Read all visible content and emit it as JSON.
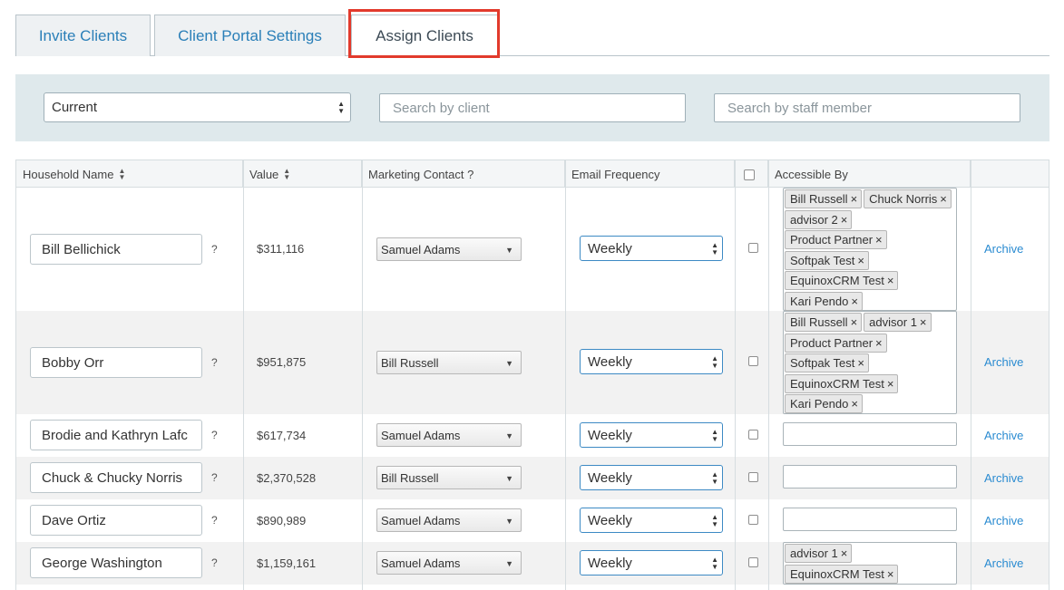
{
  "tabs": [
    {
      "label": "Invite Clients"
    },
    {
      "label": "Client Portal Settings"
    },
    {
      "label": "Assign Clients",
      "active": true
    }
  ],
  "filters": {
    "status_value": "Current",
    "client_search_placeholder": "Search by client",
    "staff_search_placeholder": "Search by staff member"
  },
  "table": {
    "headers": {
      "household": "Household Name",
      "value": "Value",
      "marketing": "Marketing Contact ?",
      "email_freq": "Email Frequency",
      "accessible": "Accessible By"
    },
    "rows": [
      {
        "name": "Bill Bellichick",
        "q": "?",
        "value": "$311,116",
        "contact": "Samuel Adams",
        "frequency": "Weekly",
        "tags": [
          "Bill Russell",
          "Chuck Norris",
          "advisor 2",
          "Product Partner",
          "Softpak Test",
          "EquinoxCRM Test",
          "Kari Pendo"
        ],
        "action": "Archive"
      },
      {
        "name": "Bobby Orr",
        "q": "?",
        "value": "$951,875",
        "contact": "Bill Russell",
        "frequency": "Weekly",
        "tags": [
          "Bill Russell",
          "advisor 1",
          "Product Partner",
          "Softpak Test",
          "EquinoxCRM Test",
          "Kari Pendo"
        ],
        "action": "Archive"
      },
      {
        "name": "Brodie and Kathryn Lafc",
        "q": "?",
        "value": "$617,734",
        "contact": "Samuel Adams",
        "frequency": "Weekly",
        "tags": [],
        "action": "Archive"
      },
      {
        "name": "Chuck & Chucky Norris",
        "q": "?",
        "value": "$2,370,528",
        "contact": "Bill Russell",
        "frequency": "Weekly",
        "tags": [],
        "action": "Archive"
      },
      {
        "name": "Dave Ortiz",
        "q": "?",
        "value": "$890,989",
        "contact": "Samuel Adams",
        "frequency": "Weekly",
        "tags": [],
        "action": "Archive"
      },
      {
        "name": "George Washington",
        "q": "?",
        "value": "$1,159,161",
        "contact": "Samuel Adams",
        "frequency": "Weekly",
        "tags": [
          "advisor 1",
          "EquinoxCRM Test"
        ],
        "action": "Archive"
      }
    ]
  },
  "colors": {
    "accent": "#2a7fb8",
    "highlight": "#e23a2c",
    "filter_bg": "#dfe9ec",
    "link": "#2a8bd1"
  }
}
